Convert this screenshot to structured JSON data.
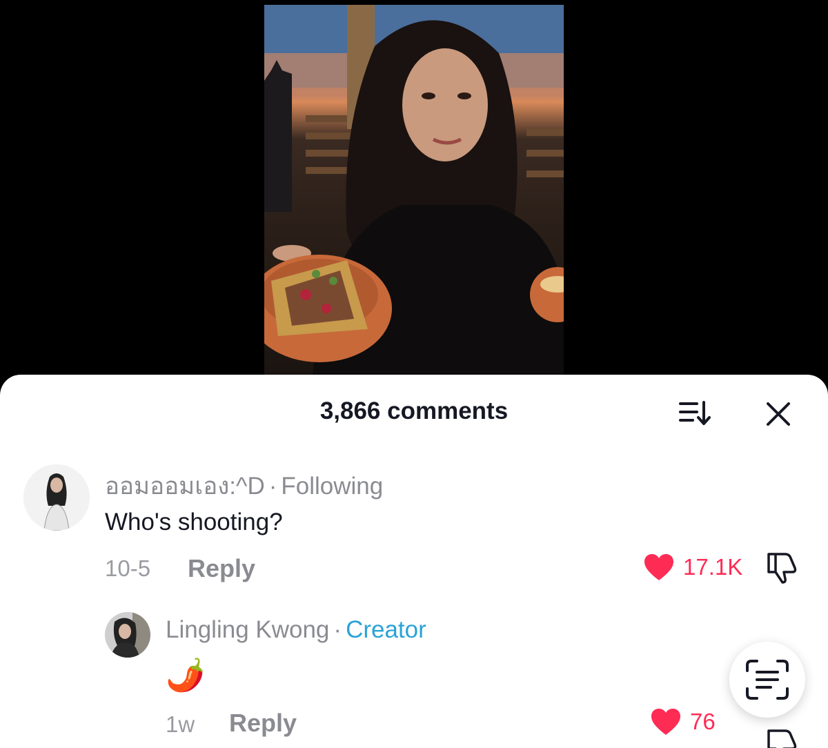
{
  "comments_panel": {
    "count_label": "3,866 comments",
    "sort_icon": "sort-descending-icon",
    "close_icon": "close-icon"
  },
  "comments": [
    {
      "username": "ออมออมเอง:^D",
      "separator": "·",
      "tag": "Following",
      "text": "Who's shooting?",
      "date": "10-5",
      "reply_label": "Reply",
      "likes": "17.1K"
    }
  ],
  "replies": [
    {
      "username": "Lingling Kwong",
      "separator": "·",
      "tag": "Creator",
      "text": "🌶️",
      "date": "1w",
      "reply_label": "Reply",
      "likes": "76"
    }
  ],
  "colors": {
    "like": "#fe2c55",
    "creator_tag": "#2aa3d6",
    "text_primary": "#161823",
    "text_secondary": "#8a8b91"
  }
}
